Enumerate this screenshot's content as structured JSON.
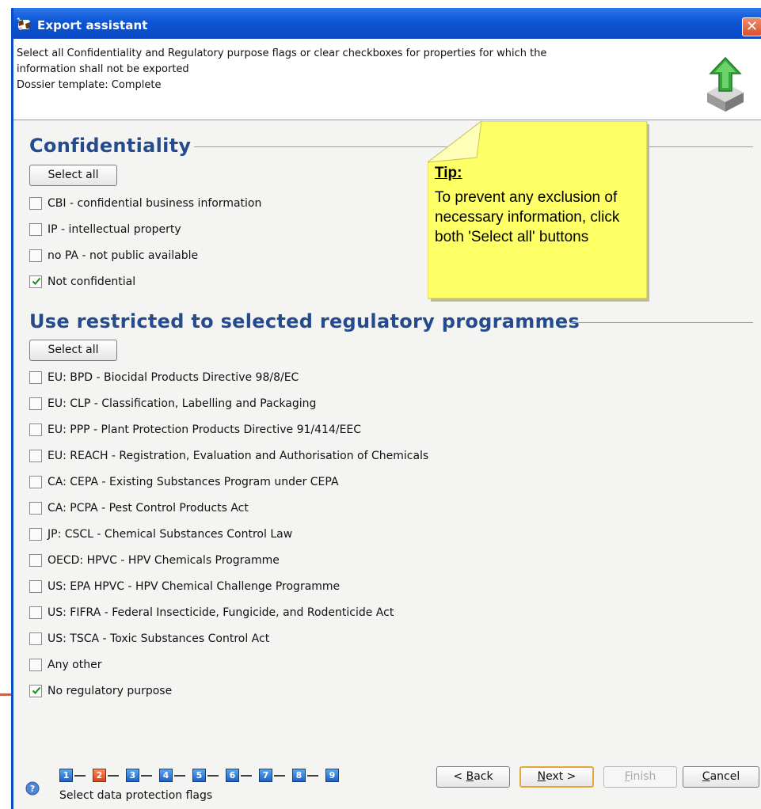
{
  "window": {
    "title": "Export assistant",
    "close_label": "✕",
    "app_icon": "cow-icon"
  },
  "header": {
    "line1": "Select all Confidentiality and Regulatory purpose flags or clear checkboxes for properties for which the",
    "line2": "information shall not be exported",
    "line3": "Dossier template: Complete",
    "icon": "export-arrow-icon"
  },
  "confidentiality": {
    "title": "Confidentiality",
    "select_all": "Select all",
    "items": [
      {
        "label": "CBI - confidential business information",
        "checked": false
      },
      {
        "label": "IP - intellectual property",
        "checked": false
      },
      {
        "label": "no PA - not public available",
        "checked": false
      },
      {
        "label": "Not confidential",
        "checked": true
      }
    ]
  },
  "regulatory": {
    "title": "Use restricted to selected regulatory programmes",
    "select_all": "Select all",
    "items": [
      {
        "label": "EU: BPD - Biocidal Products Directive 98/8/EC",
        "checked": false
      },
      {
        "label": "EU: CLP - Classification, Labelling and Packaging",
        "checked": false
      },
      {
        "label": "EU: PPP - Plant Protection Products Directive 91/414/EEC",
        "checked": false
      },
      {
        "label": "EU: REACH - Registration, Evaluation and Authorisation of Chemicals",
        "checked": false
      },
      {
        "label": "CA: CEPA - Existing Substances Program under CEPA",
        "checked": false
      },
      {
        "label": "CA: PCPA - Pest Control Products Act",
        "checked": false
      },
      {
        "label": "JP: CSCL - Chemical Substances Control Law",
        "checked": false
      },
      {
        "label": "OECD: HPVC - HPV Chemicals Programme",
        "checked": false
      },
      {
        "label": "US: EPA HPVC - HPV Chemical Challenge Programme",
        "checked": false
      },
      {
        "label": "US: FIFRA - Federal Insecticide, Fungicide, and Rodenticide Act",
        "checked": false
      },
      {
        "label": "US: TSCA - Toxic Substances Control Act",
        "checked": false
      },
      {
        "label": "Any other",
        "checked": false
      },
      {
        "label": "No regulatory purpose",
        "checked": true
      }
    ]
  },
  "tip": {
    "title": "Tip:",
    "text": "To prevent any exclusion of necessary information, click both 'Select all' buttons"
  },
  "footer": {
    "help_icon": "help-icon",
    "steps": [
      "1",
      "2",
      "3",
      "4",
      "5",
      "6",
      "7",
      "8",
      "9"
    ],
    "active_step": 2,
    "caption": "Select data protection flags",
    "back_key": "B",
    "back_rest": "ack",
    "back_prefix": "< ",
    "next_key": "N",
    "next_rest": "ext >",
    "finish_key": "F",
    "finish_rest": "inish",
    "cancel_key": "C",
    "cancel_rest": "ancel"
  },
  "colors": {
    "title_bar": "#0d55d4",
    "section_title": "#254b8f",
    "tip_note": "#ffff66",
    "active_step": "#d6451b",
    "step": "#1c62c7"
  }
}
